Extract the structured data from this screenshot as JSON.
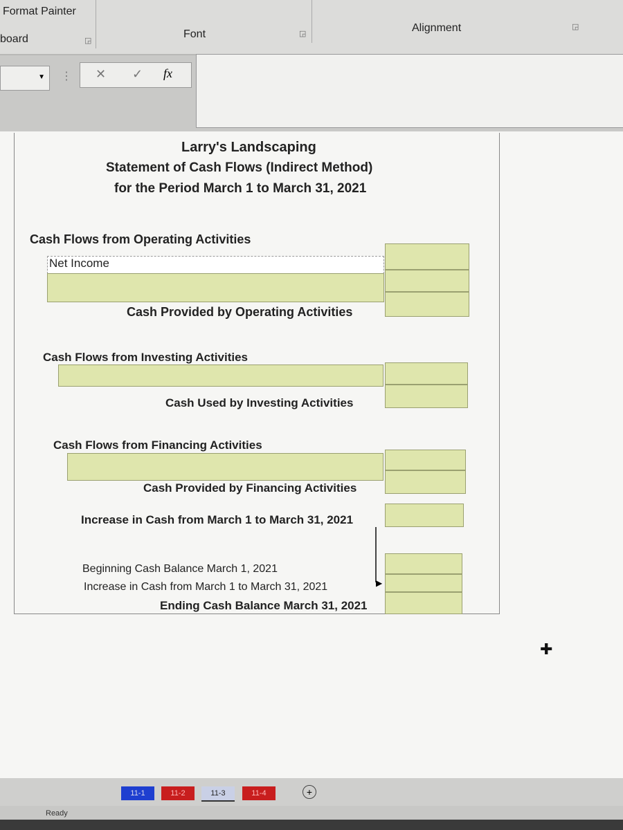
{
  "ribbon": {
    "format_painter": "Format Painter",
    "clipboard_group": "board",
    "font_group": "Font",
    "alignment_group": "Alignment"
  },
  "formula_bar": {
    "cancel": "✕",
    "enter": "✓",
    "fx": "fx",
    "value": ""
  },
  "statement": {
    "company": "Larry's Landscaping",
    "title": "Statement of Cash Flows (Indirect Method)",
    "period": "for the Period March 1 to March 31, 2021",
    "operating_header": "Cash Flows from Operating Activities",
    "net_income": "Net Income",
    "operating_total": "Cash Provided by Operating Activities",
    "investing_header": "Cash Flows from Investing Activities",
    "investing_total": "Cash Used by Investing Activities",
    "financing_header": "Cash Flows from Financing Activities",
    "financing_total": "Cash Provided by Financing Activities",
    "increase": "Increase in Cash from March 1 to March 31, 2021",
    "beginning": "Beginning Cash Balance March 1, 2021",
    "increase2": "Increase in Cash from March 1 to March 31, 2021",
    "ending": "Ending Cash Balance March 31, 2021"
  },
  "sheet_tabs": [
    {
      "label": "11-1",
      "color": "#1e3fd0"
    },
    {
      "label": "11-2",
      "color": "#c81e1e"
    },
    {
      "label": "11-3",
      "color": "#c9d0e6",
      "active": true
    },
    {
      "label": "11-4",
      "color": "#c81e1e"
    }
  ],
  "add_sheet": "+",
  "status": "Ready",
  "colors": {
    "input_cell": "#dfe6ad"
  }
}
